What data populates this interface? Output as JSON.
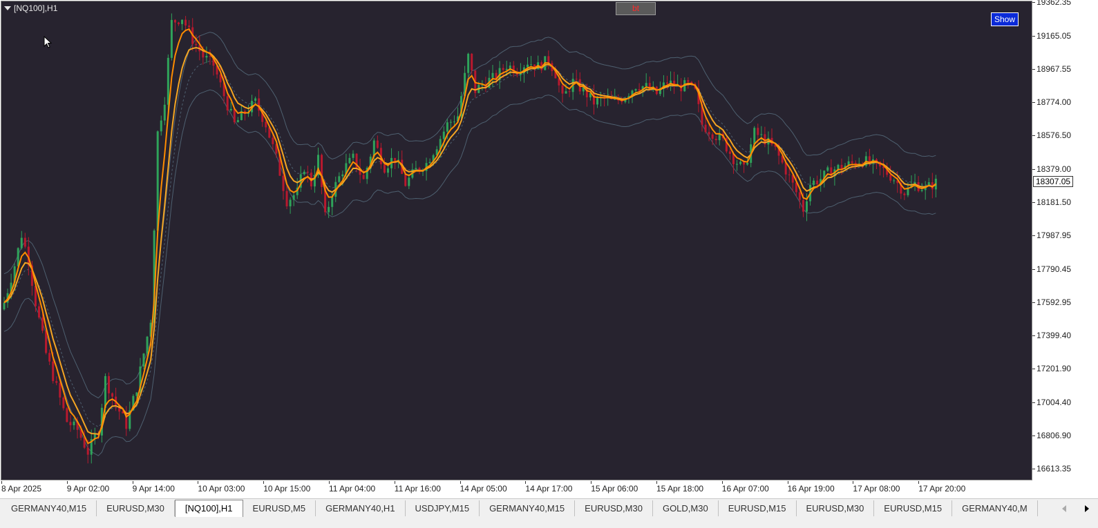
{
  "chart": {
    "symbol_label": "[NQ100],H1",
    "bt_button": "bt",
    "show_button": "Show",
    "current_price": "18307.05",
    "colors": {
      "background": "#27232f",
      "bull": "#2fa35a",
      "bear": "#b8192e",
      "ma_fast": "#ff8c00",
      "ma_slow": "#f5a623",
      "band": "#4e6070",
      "bt_text": "#ff2a2a",
      "show_bg": "#0a2ad8"
    }
  },
  "price_axis": {
    "labels": [
      "19362.35",
      "19165.05",
      "18967.55",
      "18774.00",
      "18576.50",
      "18379.00",
      "18181.50",
      "17987.95",
      "17790.45",
      "17592.95",
      "17399.40",
      "17201.90",
      "17004.40",
      "16806.90",
      "16613.35"
    ]
  },
  "time_axis": {
    "labels": [
      "8 Apr 2025",
      "9 Apr 02:00",
      "9 Apr 14:00",
      "10 Apr 03:00",
      "10 Apr 15:00",
      "11 Apr 04:00",
      "11 Apr 16:00",
      "14 Apr 05:00",
      "14 Apr 17:00",
      "15 Apr 06:00",
      "15 Apr 18:00",
      "16 Apr 07:00",
      "16 Apr 19:00",
      "17 Apr 08:00",
      "17 Apr 20:00"
    ]
  },
  "tabs": [
    {
      "label": "GERMANY40,M15",
      "active": false
    },
    {
      "label": "EURUSD,M30",
      "active": false
    },
    {
      "label": "[NQ100],H1",
      "active": true
    },
    {
      "label": "EURUSD,M5",
      "active": false
    },
    {
      "label": "GERMANY40,H1",
      "active": false
    },
    {
      "label": "USDJPY,M15",
      "active": false
    },
    {
      "label": "GERMANY40,M15",
      "active": false
    },
    {
      "label": "EURUSD,M30",
      "active": false
    },
    {
      "label": "GOLD,M30",
      "active": false
    },
    {
      "label": "EURUSD,M15",
      "active": false
    },
    {
      "label": "EURUSD,M30",
      "active": false
    },
    {
      "label": "EURUSD,M15",
      "active": false
    },
    {
      "label": "GERMANY40,M",
      "active": false
    }
  ],
  "chart_data": {
    "type": "candlestick",
    "timeframe": "H1",
    "ylim": [
      16613.35,
      19362.35
    ],
    "price_ticks": [
      19362.35,
      19165.05,
      18967.55,
      18774.0,
      18576.5,
      18379.0,
      18181.5,
      17987.95,
      17790.45,
      17592.95,
      17399.4,
      17201.9,
      17004.4,
      16806.9,
      16613.35
    ],
    "x_ticks": [
      "8 Apr 2025",
      "9 Apr 02:00",
      "9 Apr 14:00",
      "10 Apr 03:00",
      "10 Apr 15:00",
      "11 Apr 04:00",
      "11 Apr 16:00",
      "14 Apr 05:00",
      "14 Apr 17:00",
      "15 Apr 06:00",
      "15 Apr 18:00",
      "16 Apr 07:00",
      "16 Apr 19:00",
      "17 Apr 08:00",
      "17 Apr 20:00"
    ],
    "last_price": 18307.05,
    "close_path": [
      [
        0,
        17600
      ],
      [
        3,
        17820
      ],
      [
        5,
        18000
      ],
      [
        7,
        17850
      ],
      [
        9,
        17600
      ],
      [
        12,
        17300
      ],
      [
        15,
        17100
      ],
      [
        18,
        16900
      ],
      [
        21,
        16850
      ],
      [
        24,
        16720
      ],
      [
        27,
        16850
      ],
      [
        29,
        17150
      ],
      [
        32,
        17000
      ],
      [
        35,
        16880
      ],
      [
        38,
        17100
      ],
      [
        40,
        17300
      ],
      [
        42,
        17500
      ],
      [
        44,
        18600
      ],
      [
        46,
        18800
      ],
      [
        48,
        19250
      ],
      [
        51,
        19280
      ],
      [
        54,
        19150
      ],
      [
        57,
        19050
      ],
      [
        60,
        19000
      ],
      [
        63,
        18820
      ],
      [
        66,
        18650
      ],
      [
        69,
        18720
      ],
      [
        72,
        18780
      ],
      [
        75,
        18650
      ],
      [
        78,
        18450
      ],
      [
        81,
        18200
      ],
      [
        84,
        18250
      ],
      [
        86,
        18400
      ],
      [
        88,
        18300
      ],
      [
        90,
        18450
      ],
      [
        92,
        18100
      ],
      [
        94,
        18250
      ],
      [
        97,
        18380
      ],
      [
        100,
        18450
      ],
      [
        103,
        18320
      ],
      [
        106,
        18550
      ],
      [
        109,
        18400
      ],
      [
        112,
        18460
      ],
      [
        115,
        18300
      ],
      [
        118,
        18380
      ],
      [
        121,
        18420
      ],
      [
        124,
        18530
      ],
      [
        127,
        18650
      ],
      [
        130,
        18700
      ],
      [
        133,
        19050
      ],
      [
        135,
        18850
      ],
      [
        138,
        18900
      ],
      [
        141,
        18930
      ],
      [
        144,
        19000
      ],
      [
        147,
        18970
      ],
      [
        150,
        19020
      ],
      [
        153,
        18990
      ],
      [
        156,
        19030
      ],
      [
        158,
        18950
      ],
      [
        160,
        18800
      ],
      [
        163,
        18900
      ],
      [
        166,
        18850
      ],
      [
        169,
        18780
      ],
      [
        172,
        18800
      ],
      [
        175,
        18780
      ],
      [
        178,
        18820
      ],
      [
        181,
        18880
      ],
      [
        184,
        18870
      ],
      [
        187,
        18830
      ],
      [
        190,
        18900
      ],
      [
        193,
        18870
      ],
      [
        196,
        18880
      ],
      [
        198,
        18840
      ],
      [
        200,
        18650
      ],
      [
        203,
        18600
      ],
      [
        206,
        18550
      ],
      [
        209,
        18450
      ],
      [
        212,
        18380
      ],
      [
        215,
        18600
      ],
      [
        218,
        18560
      ],
      [
        221,
        18500
      ],
      [
        224,
        18380
      ],
      [
        227,
        18250
      ],
      [
        229,
        18150
      ],
      [
        231,
        18300
      ],
      [
        234,
        18330
      ],
      [
        237,
        18380
      ],
      [
        240,
        18400
      ],
      [
        243,
        18420
      ],
      [
        246,
        18440
      ],
      [
        249,
        18410
      ],
      [
        252,
        18380
      ],
      [
        255,
        18330
      ],
      [
        258,
        18250
      ],
      [
        261,
        18300
      ],
      [
        264,
        18270
      ],
      [
        267,
        18307.05
      ]
    ]
  }
}
